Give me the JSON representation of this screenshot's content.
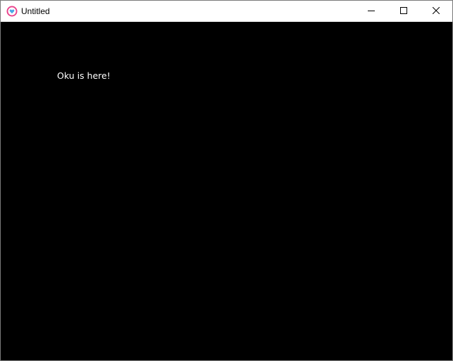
{
  "window": {
    "title": "Untitled",
    "app_icon": "heart-app-icon",
    "controls": {
      "minimize_icon": "minimize-icon",
      "maximize_icon": "maximize-icon",
      "close_icon": "close-icon"
    }
  },
  "content": {
    "text": "Oku is here!",
    "background_color": "#000000",
    "text_color": "#ffffff"
  },
  "colors": {
    "icon_pink": "#e9408a",
    "titlebar": "#ffffff"
  }
}
